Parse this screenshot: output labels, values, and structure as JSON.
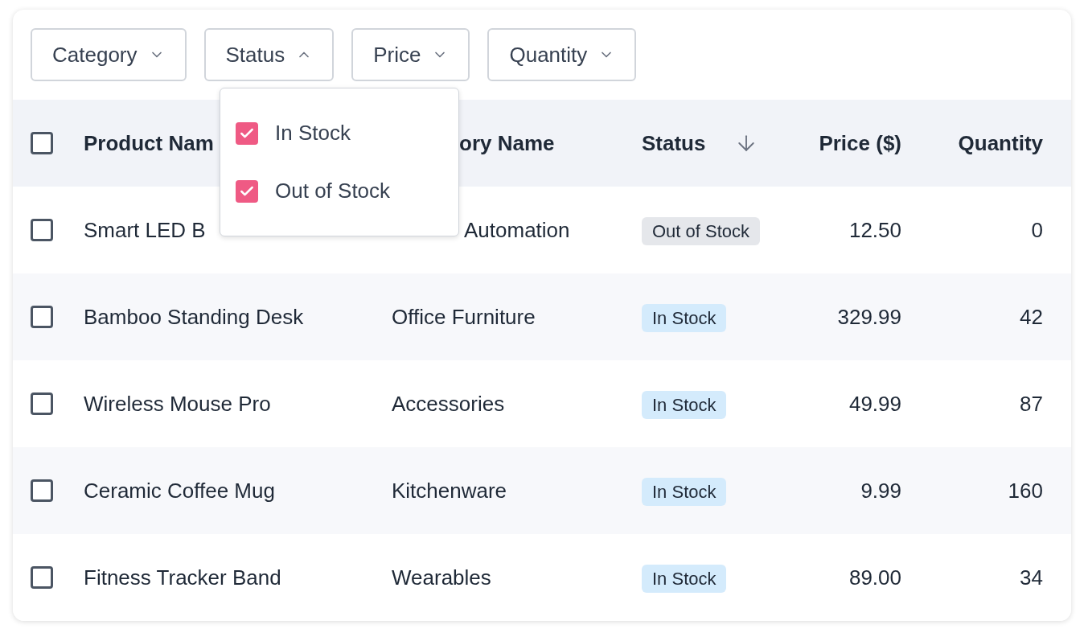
{
  "filters": [
    {
      "label": "Category",
      "expanded": false
    },
    {
      "label": "Status",
      "expanded": true
    },
    {
      "label": "Price",
      "expanded": false
    },
    {
      "label": "Quantity",
      "expanded": false
    }
  ],
  "status_menu": {
    "options": [
      {
        "label": "In Stock",
        "checked": true
      },
      {
        "label": "Out of Stock",
        "checked": true
      }
    ]
  },
  "table": {
    "select_all": {
      "checked": false
    },
    "columns": [
      {
        "label": "Product Nam",
        "sorted": false
      },
      {
        "label": "ory Name",
        "sorted": false
      },
      {
        "label": "Status",
        "sorted": true
      },
      {
        "label": "Price ($)",
        "sorted": false
      },
      {
        "label": "Quantity",
        "sorted": false
      }
    ],
    "rows": [
      {
        "checked": false,
        "product": "Smart LED B",
        "category": "Automation",
        "status": {
          "label": "Out of Stock",
          "color": "#e5e7eb"
        },
        "price": "12.50",
        "quantity": "0"
      },
      {
        "checked": false,
        "product": "Bamboo Standing Desk",
        "category": "Office Furniture",
        "status": {
          "label": "In Stock",
          "color": "#d4ebfc"
        },
        "price": "329.99",
        "quantity": "42"
      },
      {
        "checked": false,
        "product": "Wireless Mouse Pro",
        "category": "Accessories",
        "status": {
          "label": "In Stock",
          "color": "#d4ebfc"
        },
        "price": "49.99",
        "quantity": "87"
      },
      {
        "checked": false,
        "product": "Ceramic Coffee Mug",
        "category": "Kitchenware",
        "status": {
          "label": "In Stock",
          "color": "#d4ebfc"
        },
        "price": "9.99",
        "quantity": "160"
      },
      {
        "checked": false,
        "product": "Fitness Tracker Band",
        "category": "Wearables",
        "status": {
          "label": "In Stock",
          "color": "#d4ebfc"
        },
        "price": "89.00",
        "quantity": "34"
      }
    ]
  }
}
